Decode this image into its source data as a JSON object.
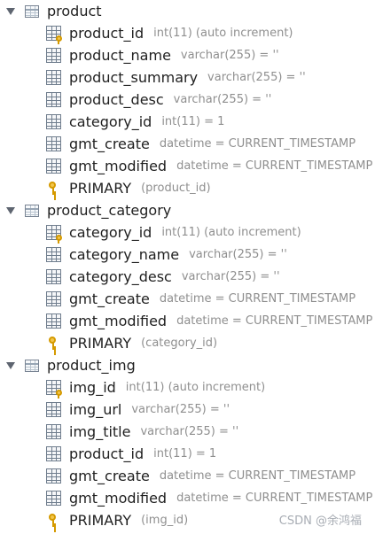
{
  "tables": [
    {
      "name": "product",
      "columns": [
        {
          "name": "product_id",
          "type": "int(11) (auto increment)"
        },
        {
          "name": "product_name",
          "type": "varchar(255) = ''"
        },
        {
          "name": "product_summary",
          "type": "varchar(255) = ''"
        },
        {
          "name": "product_desc",
          "type": "varchar(255) = ''"
        },
        {
          "name": "category_id",
          "type": "int(11) = 1"
        },
        {
          "name": "gmt_create",
          "type": "datetime = CURRENT_TIMESTAMP"
        },
        {
          "name": "gmt_modified",
          "type": "datetime = CURRENT_TIMESTAMP"
        }
      ],
      "key": {
        "name": "PRIMARY",
        "type": "(product_id)"
      }
    },
    {
      "name": "product_category",
      "columns": [
        {
          "name": "category_id",
          "type": "int(11) (auto increment)"
        },
        {
          "name": "category_name",
          "type": "varchar(255) = ''"
        },
        {
          "name": "category_desc",
          "type": "varchar(255) = ''"
        },
        {
          "name": "gmt_create",
          "type": "datetime = CURRENT_TIMESTAMP"
        },
        {
          "name": "gmt_modified",
          "type": "datetime = CURRENT_TIMESTAMP"
        }
      ],
      "key": {
        "name": "PRIMARY",
        "type": "(category_id)"
      }
    },
    {
      "name": "product_img",
      "columns": [
        {
          "name": "img_id",
          "type": "int(11) (auto increment)"
        },
        {
          "name": "img_url",
          "type": "varchar(255) = ''"
        },
        {
          "name": "img_title",
          "type": "varchar(255) = ''"
        },
        {
          "name": "product_id",
          "type": "int(11) = 1"
        },
        {
          "name": "gmt_create",
          "type": "datetime = CURRENT_TIMESTAMP"
        },
        {
          "name": "gmt_modified",
          "type": "datetime = CURRENT_TIMESTAMP"
        }
      ],
      "key": {
        "name": "PRIMARY",
        "type": "(img_id)"
      }
    }
  ],
  "watermark": "CSDN @余鸿福",
  "icons": {
    "table": "table-icon",
    "column": "column-icon",
    "primary_column": "primary-key-column-icon",
    "key": "key-icon"
  }
}
